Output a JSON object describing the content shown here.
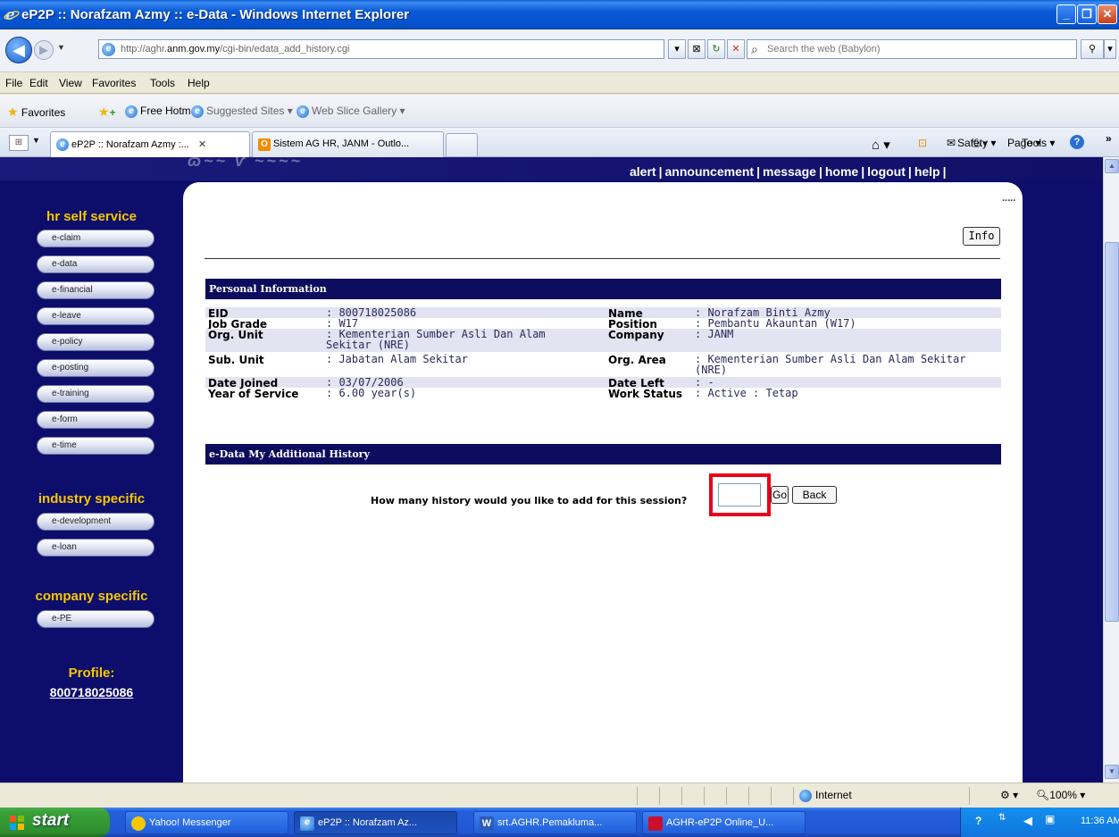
{
  "window": {
    "title": "eP2P :: Norafzam Azmy :: e-Data - Windows Internet Explorer",
    "minimize": "_",
    "maximize": "❐",
    "close": "✕"
  },
  "address_bar": {
    "url_prefix": "http://aghr.",
    "url_domain": "anm.gov.my",
    "url_path": "/cgi-bin/edata_add_history.cgi",
    "search_placeholder": "Search the web (Babylon)"
  },
  "menu": [
    "File",
    "Edit",
    "View",
    "Favorites",
    "Tools",
    "Help"
  ],
  "favorites_bar": {
    "favorites_label": "Favorites",
    "items": [
      "Free Hotmail",
      "Suggested Sites ▾",
      "Web Slice Gallery ▾"
    ]
  },
  "tabs": [
    {
      "label": "eP2P :: Norafzam Azmy :...",
      "close": "✕"
    },
    {
      "label": "Sistem AG HR, JANM - Outlo..."
    }
  ],
  "command_bar": [
    "Page ▾",
    "Safety ▾",
    "Tools ▾"
  ],
  "page": {
    "top_links": [
      "alert",
      "announcement",
      "message",
      "home",
      "logout",
      "help"
    ],
    "sidebar": {
      "hr_heading": "hr self service",
      "hr_items": [
        "e-claim",
        "e-data",
        "e-financial",
        "e-leave",
        "e-policy",
        "e-posting",
        "e-training",
        "e-form",
        "e-time"
      ],
      "industry_heading": "industry specific",
      "industry_items": [
        "e-development",
        "e-loan"
      ],
      "company_heading": "company specific",
      "company_items": [
        "e-PE"
      ],
      "profile_heading": "Profile:",
      "profile_id": "800718025086"
    },
    "dots": ".....",
    "info_button": "Info",
    "personal_info": {
      "header": "Personal Information",
      "rows": [
        {
          "l1": "EID",
          "v1": ": 800718025086",
          "l2": "Name",
          "v2": ": Norafzam Binti Azmy"
        },
        {
          "l1": "Job Grade",
          "v1": ": W17",
          "l2": "Position",
          "v2": ": Pembantu Akauntan (W17)"
        },
        {
          "l1": "Org. Unit",
          "v1": ": Kementerian Sumber Asli Dan Alam Sekitar (NRE)",
          "l2": "Company",
          "v2": ": JANM"
        },
        {
          "l1": "Sub. Unit",
          "v1": ": Jabatan Alam Sekitar",
          "l2": "Org. Area",
          "v2": ": Kementerian Sumber Asli Dan Alam Sekitar (NRE)"
        },
        {
          "l1": "Date Joined",
          "v1": ": 03/07/2006",
          "l2": "Date Left",
          "v2": ": -"
        },
        {
          "l1": "Year of Service",
          "v1": ": 6.00 year(s)",
          "l2": "Work Status",
          "v2": ": Active : Tetap"
        }
      ]
    },
    "history": {
      "header": "e-Data My Additional History",
      "question": "How many history would you like to add for this session?",
      "input_value": "",
      "go_button": "Go",
      "back_button": "Back"
    }
  },
  "status_bar": {
    "zone": "Internet",
    "zoom": "100%"
  },
  "taskbar": {
    "start": "start",
    "tasks": [
      "Yahoo! Messenger",
      "eP2P :: Norafzam Az...",
      "srt.AGHR.Pemakluma...",
      "AGHR-eP2P Online_U..."
    ],
    "clock": "11:36 AM"
  }
}
